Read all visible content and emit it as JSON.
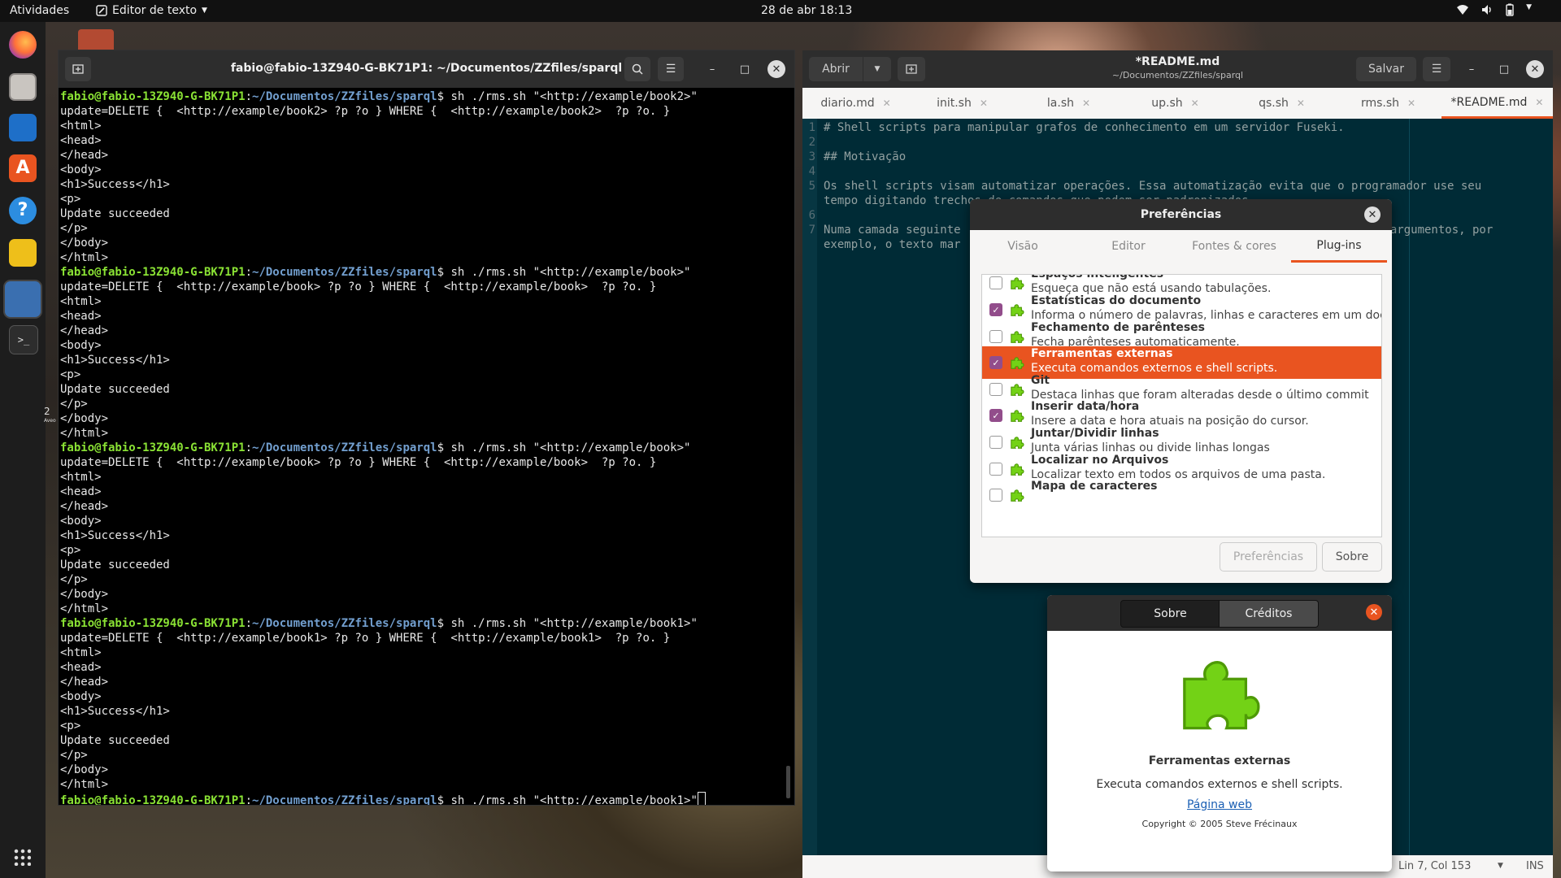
{
  "topbar": {
    "activities": "Atividades",
    "app_menu": "Editor de texto",
    "clock": "28 de abr  18:13"
  },
  "dock": {
    "workspace_number": "2",
    "workspace_label": "Aveo"
  },
  "terminal": {
    "title": "fabio@fabio-13Z940-G-BK71P1: ~/Documentos/ZZfiles/sparql",
    "prompt_user": "fabio@fabio-13Z940-G-BK71P1",
    "prompt_path": "~/Documentos/ZZfiles/sparql",
    "lines": [
      {
        "prompt": true,
        "text": " sh ./rms.sh \"<http://example/book2>\""
      },
      {
        "prompt": false,
        "text": "update=DELETE {  <http://example/book2> ?p ?o } WHERE {  <http://example/book2>  ?p ?o. }"
      },
      {
        "prompt": false,
        "text": "<html>"
      },
      {
        "prompt": false,
        "text": "<head>"
      },
      {
        "prompt": false,
        "text": "</head>"
      },
      {
        "prompt": false,
        "text": "<body>"
      },
      {
        "prompt": false,
        "text": "<h1>Success</h1>"
      },
      {
        "prompt": false,
        "text": "<p>"
      },
      {
        "prompt": false,
        "text": "Update succeeded"
      },
      {
        "prompt": false,
        "text": "</p>"
      },
      {
        "prompt": false,
        "text": "</body>"
      },
      {
        "prompt": false,
        "text": "</html>"
      },
      {
        "prompt": true,
        "text": " sh ./rms.sh \"<http://example/book>\""
      },
      {
        "prompt": false,
        "text": "update=DELETE {  <http://example/book> ?p ?o } WHERE {  <http://example/book>  ?p ?o. }"
      },
      {
        "prompt": false,
        "text": "<html>"
      },
      {
        "prompt": false,
        "text": "<head>"
      },
      {
        "prompt": false,
        "text": "</head>"
      },
      {
        "prompt": false,
        "text": "<body>"
      },
      {
        "prompt": false,
        "text": "<h1>Success</h1>"
      },
      {
        "prompt": false,
        "text": "<p>"
      },
      {
        "prompt": false,
        "text": "Update succeeded"
      },
      {
        "prompt": false,
        "text": "</p>"
      },
      {
        "prompt": false,
        "text": "</body>"
      },
      {
        "prompt": false,
        "text": "</html>"
      },
      {
        "prompt": true,
        "text": " sh ./rms.sh \"<http://example/book>\""
      },
      {
        "prompt": false,
        "text": "update=DELETE {  <http://example/book> ?p ?o } WHERE {  <http://example/book>  ?p ?o. }"
      },
      {
        "prompt": false,
        "text": "<html>"
      },
      {
        "prompt": false,
        "text": "<head>"
      },
      {
        "prompt": false,
        "text": "</head>"
      },
      {
        "prompt": false,
        "text": "<body>"
      },
      {
        "prompt": false,
        "text": "<h1>Success</h1>"
      },
      {
        "prompt": false,
        "text": "<p>"
      },
      {
        "prompt": false,
        "text": "Update succeeded"
      },
      {
        "prompt": false,
        "text": "</p>"
      },
      {
        "prompt": false,
        "text": "</body>"
      },
      {
        "prompt": false,
        "text": "</html>"
      },
      {
        "prompt": true,
        "text": " sh ./rms.sh \"<http://example/book1>\""
      },
      {
        "prompt": false,
        "text": "update=DELETE {  <http://example/book1> ?p ?o } WHERE {  <http://example/book1>  ?p ?o. }"
      },
      {
        "prompt": false,
        "text": "<html>"
      },
      {
        "prompt": false,
        "text": "<head>"
      },
      {
        "prompt": false,
        "text": "</head>"
      },
      {
        "prompt": false,
        "text": "<body>"
      },
      {
        "prompt": false,
        "text": "<h1>Success</h1>"
      },
      {
        "prompt": false,
        "text": "<p>"
      },
      {
        "prompt": false,
        "text": "Update succeeded"
      },
      {
        "prompt": false,
        "text": "</p>"
      },
      {
        "prompt": false,
        "text": "</body>"
      },
      {
        "prompt": false,
        "text": "</html>"
      },
      {
        "prompt": true,
        "text": " sh ./rms.sh \"<http://example/book1>\"",
        "cursor": true
      }
    ]
  },
  "editor": {
    "open_label": "Abrir",
    "save_label": "Salvar",
    "title": "*README.md",
    "subtitle": "~/Documentos/ZZfiles/sparql",
    "tabs": [
      {
        "label": "diario.md",
        "active": false
      },
      {
        "label": "init.sh",
        "active": false
      },
      {
        "label": "la.sh",
        "active": false
      },
      {
        "label": "up.sh",
        "active": false
      },
      {
        "label": "qs.sh",
        "active": false
      },
      {
        "label": "rms.sh",
        "active": false
      },
      {
        "label": "*README.md",
        "active": true
      }
    ],
    "lines": [
      {
        "num": "1",
        "text": "# Shell scripts para manipular grafos de conhecimento em um servidor Fuseki."
      },
      {
        "num": "2",
        "text": ""
      },
      {
        "num": "3",
        "text": "## Motivação"
      },
      {
        "num": "4",
        "text": ""
      },
      {
        "num": "5",
        "text": "Os shell scripts visam automatizar operações. Essa automatização evita que o programador use seu"
      },
      {
        "num": "",
        "text": "tempo digitando trechos de comandos que podem ser padronizados."
      },
      {
        "num": "6",
        "text": ""
      },
      {
        "num": "7",
        "text": "Numa camada seguinte",
        "highlight": true,
        "tail": "o argumentos, por"
      },
      {
        "num": "",
        "text": "exemplo, o texto mar",
        "highlight": true
      }
    ],
    "status": {
      "position": "Lin 7, Col 153",
      "mode": "INS"
    }
  },
  "preferences": {
    "title": "Preferências",
    "tabs": [
      "Visão",
      "Editor",
      "Fontes & cores",
      "Plug-ins"
    ],
    "active_tab": "Plug-ins",
    "plugins": [
      {
        "name": "Espaços inteligentes",
        "desc": "Esqueça que não está usando tabulações.",
        "checked": false,
        "selected": false
      },
      {
        "name": "Estatísticas do documento",
        "desc": "Informa o número de palavras, linhas e caracteres em um docu…",
        "checked": true,
        "selected": false
      },
      {
        "name": "Fechamento de parênteses",
        "desc": "Fecha parênteses automaticamente.",
        "checked": false,
        "selected": false
      },
      {
        "name": "Ferramentas externas",
        "desc": "Executa comandos externos e shell scripts.",
        "checked": true,
        "selected": true
      },
      {
        "name": "Git",
        "desc": "Destaca linhas que foram alteradas desde o último commit",
        "checked": false,
        "selected": false
      },
      {
        "name": "Inserir data/hora",
        "desc": "Insere a data e hora atuais na posição do cursor.",
        "checked": true,
        "selected": false
      },
      {
        "name": "Juntar/Dividir linhas",
        "desc": "Junta várias linhas ou divide linhas longas",
        "checked": false,
        "selected": false
      },
      {
        "name": "Localizar no Arquivos",
        "desc": "Localizar texto em todos os arquivos de uma pasta.",
        "checked": false,
        "selected": false
      },
      {
        "name": "Mapa de caracteres",
        "desc": "",
        "checked": false,
        "selected": false
      }
    ],
    "prefs_button": "Preferências",
    "about_button": "Sobre"
  },
  "about": {
    "tab_about": "Sobre",
    "tab_credits": "Créditos",
    "name": "Ferramentas externas",
    "description": "Executa comandos externos e shell scripts.",
    "website": "Página web",
    "copyright": "Copyright © 2005 Steve Frécinaux"
  },
  "colors": {
    "accent": "#e95420",
    "checkbox": "#924d8b",
    "terminal_user": "#8ae234",
    "terminal_path": "#729fcf",
    "editor_bg": "#002b36",
    "puzzle_green": "#73d216"
  }
}
